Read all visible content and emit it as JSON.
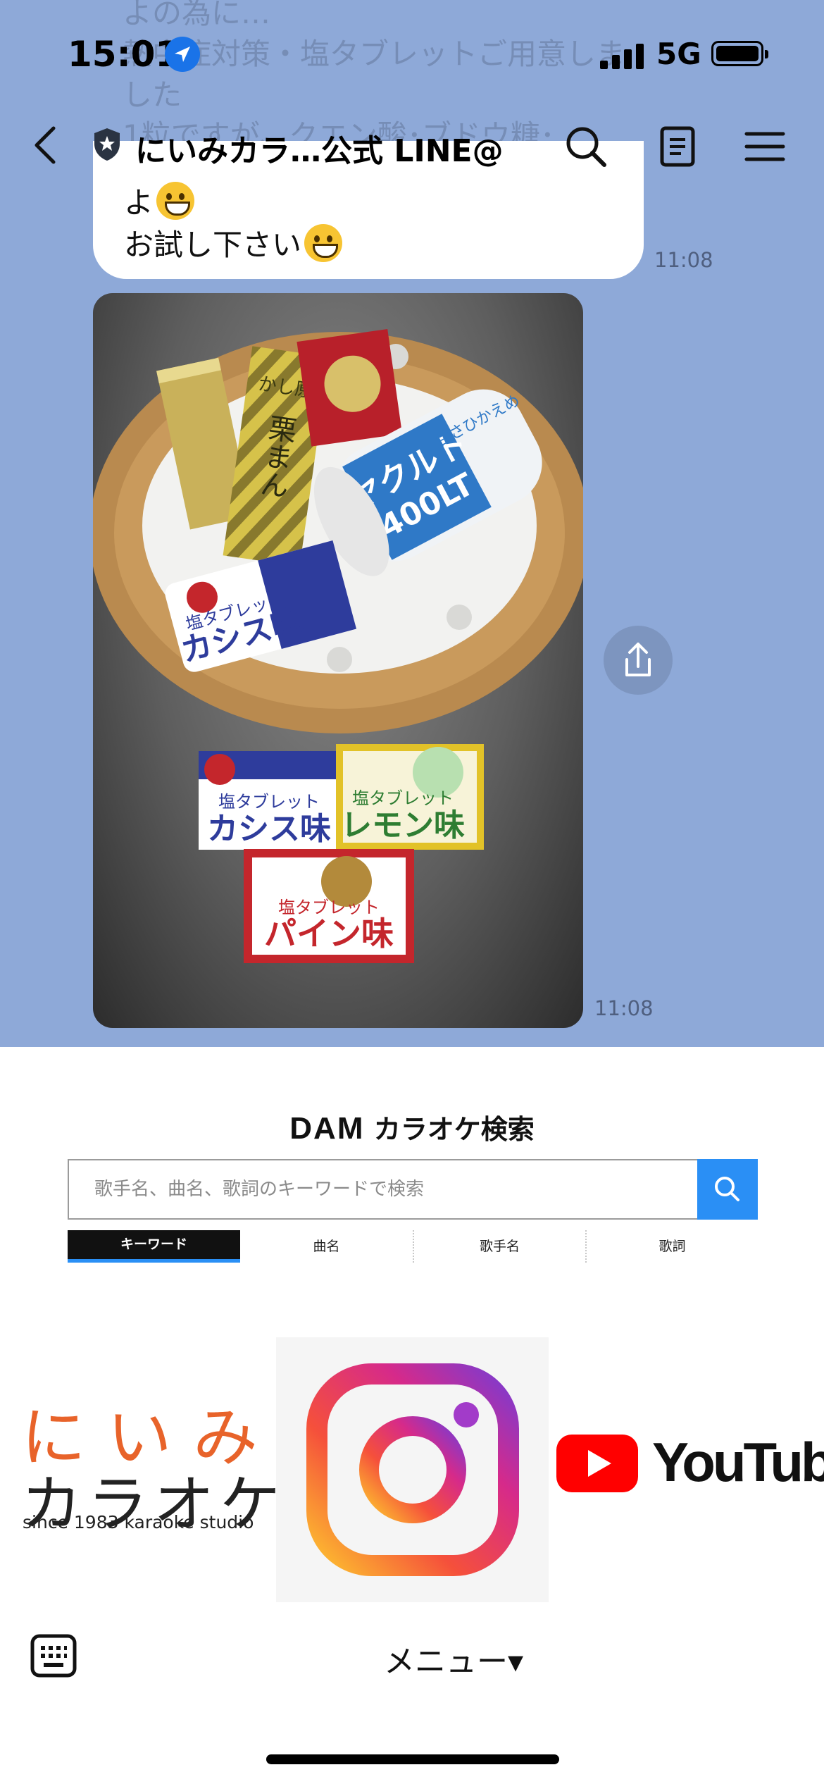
{
  "status_bar": {
    "time": "15:01",
    "network": "5G"
  },
  "chat": {
    "title": "にいみカラ…公式 LINE@",
    "previous_message_fragment": "よの為に…\n熱中症対策・塩タブレットご用意しま\nした\n1粒ですが、クエン酸･ブドウ糖･\n塩分補給のサポートになります",
    "message_lines": [
      "よ",
      "お試し下さい"
    ],
    "message_time": "11:08",
    "photo_time": "11:08",
    "photo_labels": {
      "calpis_bag_text": "塩タブレット",
      "calpis_flavor": "カシス味",
      "lemon_text": "塩タブレット",
      "lemon_flavor": "レモン味",
      "pine_text": "塩タブレット",
      "pine_flavor": "パイン味",
      "yakult_brand": "ヤクルト",
      "yakult_size": "400LT",
      "yakult_sub": "甘さひかえめ",
      "kuri_text": "栗まん",
      "kuri_top": "かし原"
    }
  },
  "rich_menu": {
    "dam_brand": "DAM",
    "dam_title": "カラオケ検索",
    "search_placeholder": "歌手名、曲名、歌詞のキーワードで検索",
    "tabs": [
      "キーワード",
      "曲名",
      "歌手名",
      "歌詞"
    ],
    "niimi_logo_top": "にいみ",
    "niimi_logo_mid": "カラオケ",
    "niimi_logo_sub": "since 1983 karaoke studio",
    "youtube_word": "YouTube"
  },
  "bottom_bar": {
    "menu_label": "メニュー▾"
  },
  "colors": {
    "chat_background": "#8ea9d8",
    "search_button": "#2a8ff5",
    "youtube_red": "#ff0000",
    "niimi_orange": "#e8632a"
  }
}
